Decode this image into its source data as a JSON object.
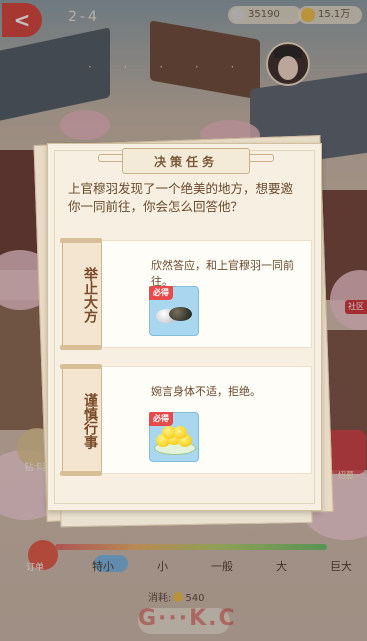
{
  "hud": {
    "back_label": "<",
    "level": "2-4",
    "silver": "35190",
    "gold": "15.1万",
    "dots": "·  ·  ·  ·  ·  ·"
  },
  "side_tag": "社区",
  "left_button_label": "钻卡奖",
  "right_button_label": "招募",
  "bottom": {
    "left_label": "订单",
    "sizes": [
      "特小",
      "小",
      "一般",
      "大",
      "巨大"
    ],
    "cost_label": "消耗:",
    "cost_value": "540",
    "watermark": "G···K.C"
  },
  "dialog": {
    "title": "决策任务",
    "question": "上官穆羽发现了一个绝美的地方，想要邀你一同前往，你会怎么回答他？",
    "options": [
      {
        "tab": "举止大方",
        "text": "欣然答应，和上官穆羽一同前往。",
        "badge": "必得",
        "reward_icon": "stones-icon"
      },
      {
        "tab": "谨慎行事",
        "text": "婉言身体不适，拒绝。",
        "badge": "必得",
        "reward_icon": "ducks-icon"
      }
    ]
  }
}
